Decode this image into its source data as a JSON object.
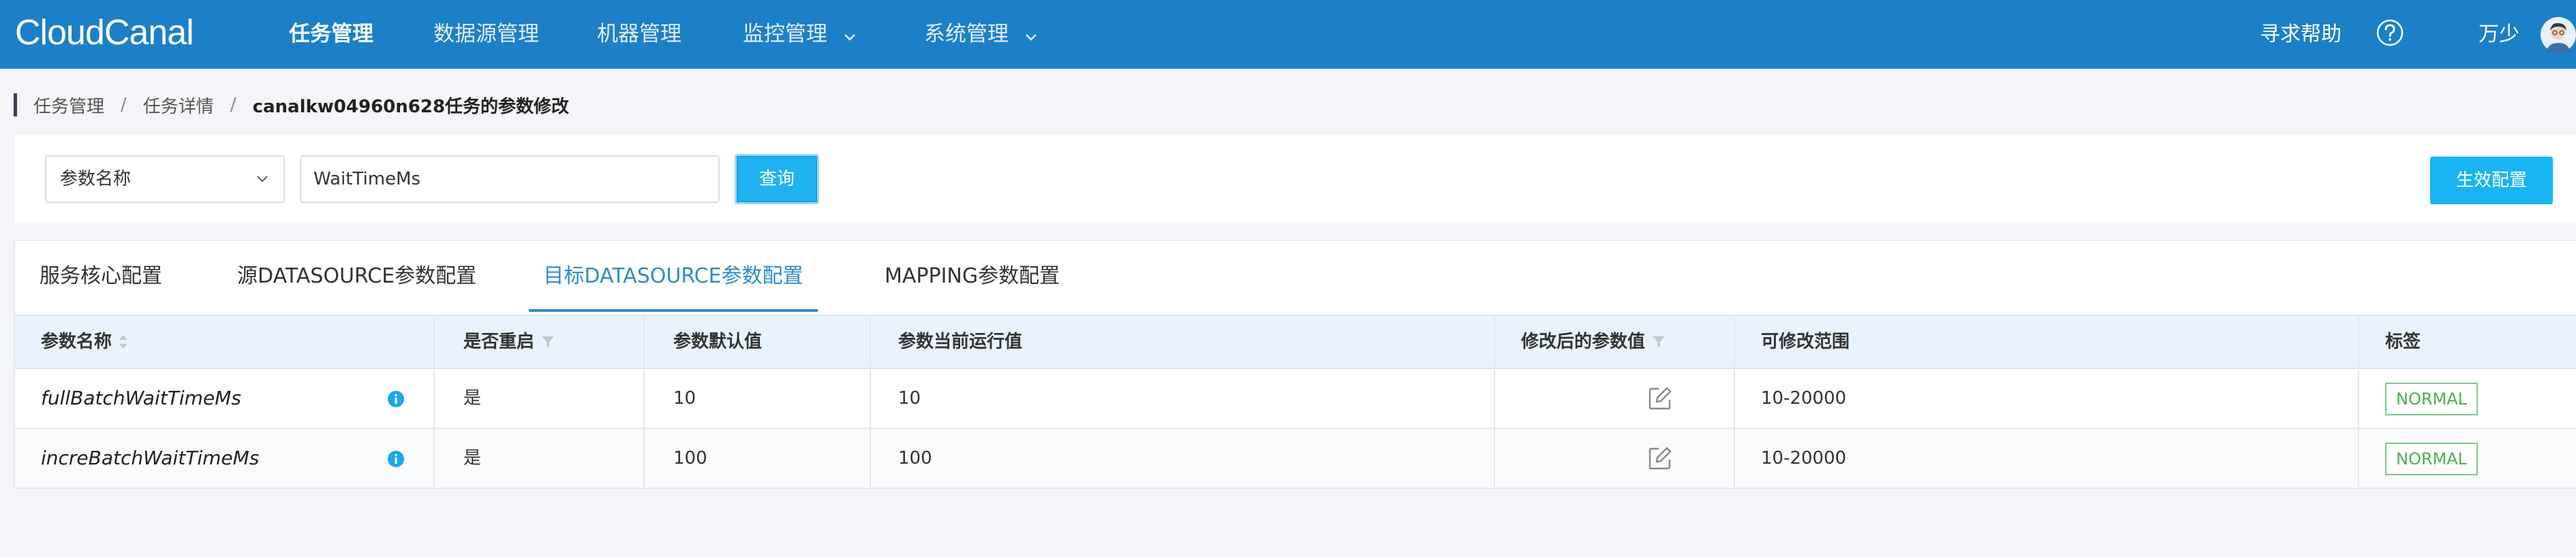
{
  "app": {
    "logo": "CloudCanal"
  },
  "nav": {
    "items": [
      {
        "label": "任务管理",
        "active": true
      },
      {
        "label": "数据源管理",
        "active": false
      },
      {
        "label": "机器管理",
        "active": false
      },
      {
        "label": "监控管理",
        "active": false,
        "dropdown": true
      },
      {
        "label": "系统管理",
        "active": false,
        "dropdown": true
      }
    ],
    "help": "寻求帮助",
    "user": "万少"
  },
  "breadcrumb": {
    "items": [
      "任务管理",
      "任务详情"
    ],
    "separator": "/",
    "current": "canalkw04960n628任务的参数修改"
  },
  "filter": {
    "select_value": "参数名称",
    "input_value": "WaitTimeMs",
    "query_label": "查询",
    "apply_label": "生效配置"
  },
  "tabs": [
    {
      "label": "服务核心配置",
      "active": false
    },
    {
      "label": "源DATASOURCE参数配置",
      "active": false
    },
    {
      "label": "目标DATASOURCE参数配置",
      "active": true
    },
    {
      "label": "MAPPING参数配置",
      "active": false
    }
  ],
  "table": {
    "columns": [
      {
        "label": "参数名称",
        "sortable": true
      },
      {
        "label": "是否重启",
        "filterable": true
      },
      {
        "label": "参数默认值"
      },
      {
        "label": "参数当前运行值"
      },
      {
        "label": "修改后的参数值",
        "filterable": true
      },
      {
        "label": "可修改范围"
      },
      {
        "label": "标签"
      }
    ],
    "rows": [
      {
        "name": "fullBatchWaitTimeMs",
        "restart": "是",
        "default": "10",
        "current": "10",
        "modified": "",
        "range": "10-20000",
        "tag": "NORMAL"
      },
      {
        "name": "increBatchWaitTimeMs",
        "restart": "是",
        "default": "100",
        "current": "100",
        "modified": "",
        "range": "10-20000",
        "tag": "NORMAL"
      }
    ]
  },
  "colors": {
    "nav_bg": "#1b80c8",
    "accent": "#2d8ccd",
    "primary_button": "#19b5f2",
    "tag_green": "#4caf50"
  }
}
